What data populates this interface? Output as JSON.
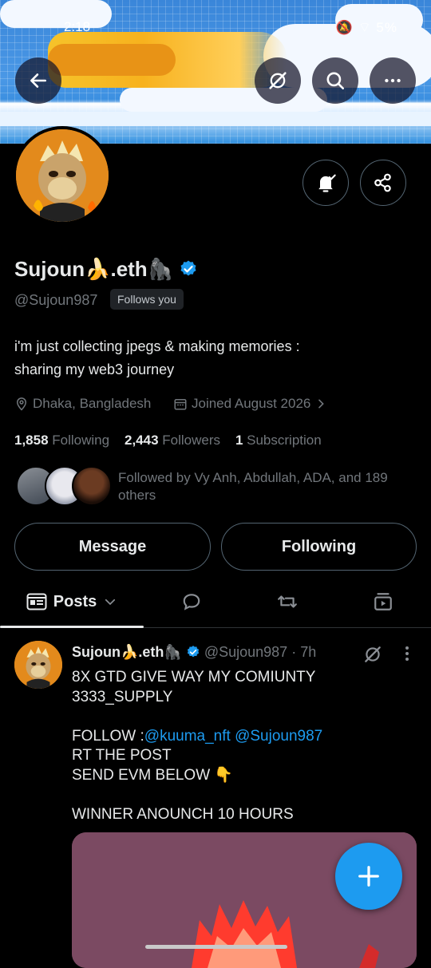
{
  "status_bar": {
    "time": "2:18",
    "battery": "5%"
  },
  "profile": {
    "name": "Sujoun🍌.eth🦍",
    "handle": "@Sujoun987",
    "follows_you": "Follows you",
    "bio_line1": "i'm just collecting jpegs & making memories :",
    "bio_line2": "sharing my web3 journey",
    "location": "Dhaka, Bangladesh",
    "joined": "Joined August 2026",
    "following_count": "1,858",
    "following_label": "Following",
    "followers_count": "2,443",
    "followers_label": "Followers",
    "subscription_count": "1",
    "subscription_label": "Subscription",
    "followed_by": "Followed by Vy Anh, Abdullah, ADA, and 189 others"
  },
  "actions": {
    "message": "Message",
    "following": "Following"
  },
  "tabs": {
    "posts": "Posts"
  },
  "post": {
    "name": "Sujoun🍌.eth🦍",
    "handle_time": "@Sujoun987 · 7h",
    "line1": "8X GTD GIVE WAY MY COMIUNTY",
    "line2": "3333_SUPPLY",
    "follow_prefix": "FOLLOW :",
    "mention1": "@kuuma_nft",
    "mention2": "@Sujoun987",
    "line4": "RT THE POST",
    "line5": "SEND EVM  BELOW 👇",
    "line6": "WINNER ANOUNCH 10 HOURS"
  },
  "colors": {
    "accent": "#1d9bf0",
    "background": "#000000",
    "muted": "#71767b"
  }
}
